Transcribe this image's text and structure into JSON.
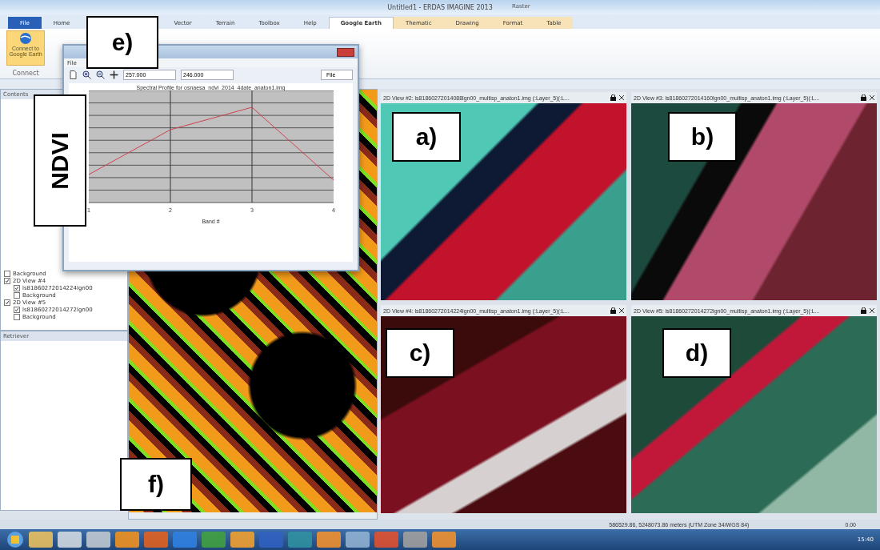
{
  "window": {
    "title": "Untitled1 - ERDAS IMAGINE 2013"
  },
  "ribbon_tabs": [
    {
      "label": "File",
      "selected": false,
      "kind": "file"
    },
    {
      "label": "Home",
      "selected": false,
      "kind": "tab"
    },
    {
      "label": "Vector",
      "selected": false,
      "kind": "tab"
    },
    {
      "label": "Terrain",
      "selected": false,
      "kind": "tab"
    },
    {
      "label": "Toolbox",
      "selected": false,
      "kind": "tab"
    },
    {
      "label": "Help",
      "selected": false,
      "kind": "tab"
    },
    {
      "label": "Google Earth",
      "selected": true,
      "kind": "tab"
    },
    {
      "label": "Thematic",
      "selected": false,
      "kind": "tab"
    },
    {
      "label": "Drawing",
      "selected": false,
      "kind": "tab"
    },
    {
      "label": "Format",
      "selected": false,
      "kind": "tab"
    },
    {
      "label": "Table",
      "selected": false,
      "kind": "tab"
    }
  ],
  "context_group": "Raster",
  "ribbon": {
    "button": "Connect to Google Earth",
    "group": "Connect"
  },
  "contents": {
    "title": "Contents",
    "items": [
      {
        "label": "Background",
        "checked": false
      },
      {
        "label": "2D View #4",
        "checked": true,
        "children": [
          {
            "label": "ls81860272014224lgn00",
            "checked": true
          },
          {
            "label": "Background",
            "checked": false
          }
        ]
      },
      {
        "label": "2D View #5",
        "checked": true,
        "children": [
          {
            "label": "ls81860272014272lgn00",
            "checked": true
          },
          {
            "label": "Background",
            "checked": false
          }
        ]
      }
    ]
  },
  "retriever": {
    "title": "Retriever"
  },
  "profile_window": {
    "menu": "File",
    "x_value": "257.000",
    "y_value": "246.000",
    "dropdown": "File",
    "chart_title": "Spectral Profile for osnaesa_ndvi_2014_4date_anaton1.img",
    "xlabel": "Band #",
    "xticks": [
      "1",
      "2",
      "3",
      "4"
    ]
  },
  "views": [
    {
      "title": "2D View #2: ls81860272014088lgn00_multisp_anaton1.img (:Layer_5)(:L..."
    },
    {
      "title": "2D View #3: ls81860272014160lgn00_multisp_anaton1.img (:Layer_5)(:L..."
    },
    {
      "title": "2D View #4: ls81860272014224lgn00_multisp_anaton1.img (:Layer_5)(:L..."
    },
    {
      "title": "2D View #5: ls81860272014272lgn00_multisp_anaton1.img (:Layer_5)(:L..."
    }
  ],
  "annotations": {
    "views": [
      "a)",
      "b)",
      "c)",
      "d)"
    ],
    "window": "e)",
    "map": "f)",
    "axis": "NDVI"
  },
  "status_bar": {
    "coordinates": "586529.86, 5248073.86 meters (UTM Zone 34/WGS 84)",
    "value": "0.00"
  },
  "taskbar": {
    "time": "15:40"
  }
}
